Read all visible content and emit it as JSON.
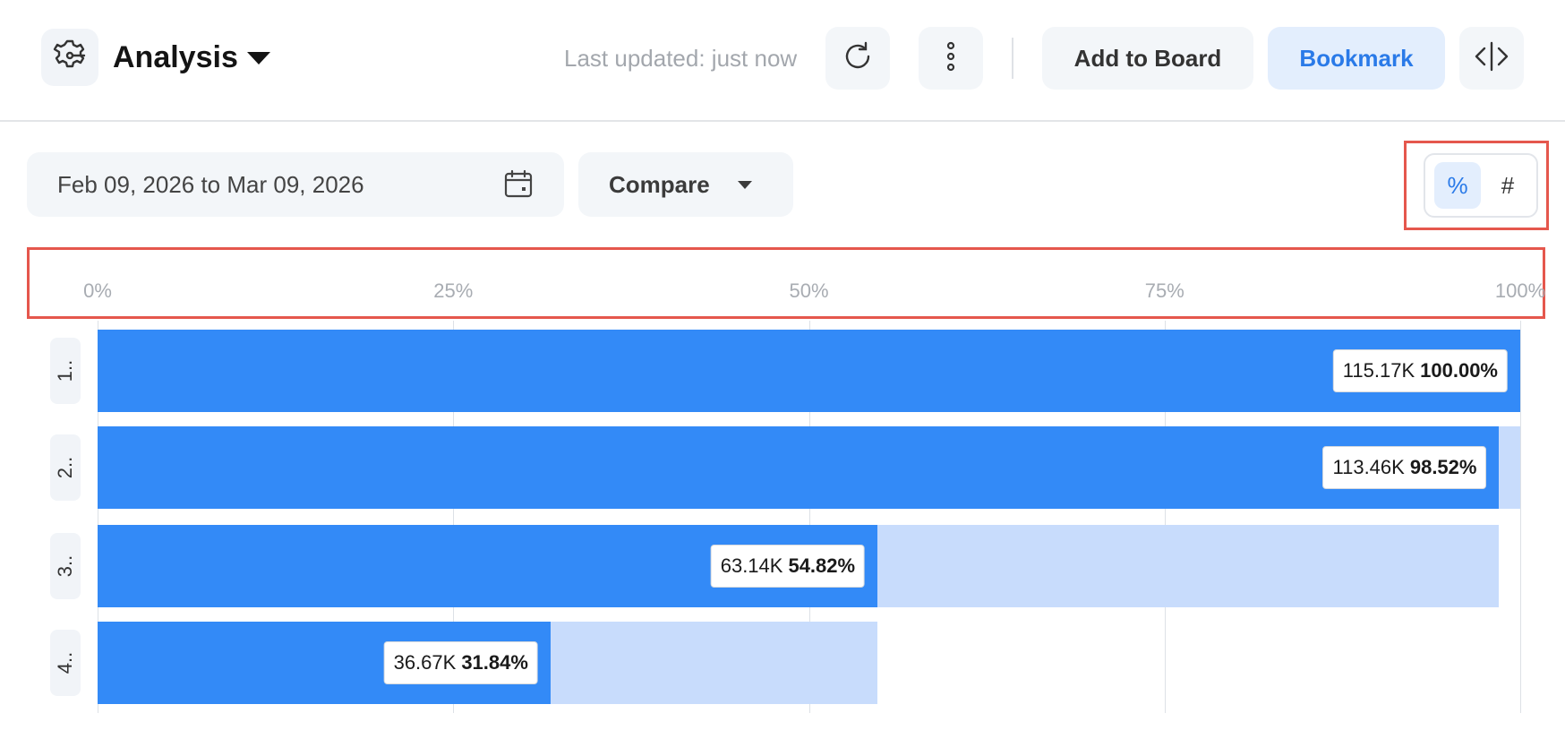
{
  "header": {
    "title": "Analysis",
    "last_updated": "Last updated: just now",
    "add_to_board_label": "Add to Board",
    "bookmark_label": "Bookmark"
  },
  "toolbar": {
    "date_range": "Feb 09, 2026 to Mar 09, 2026",
    "compare_label": "Compare",
    "toggle": {
      "percent_label": "%",
      "count_label": "#",
      "selected": "percent"
    }
  },
  "icons": {
    "app": "gear-flow-icon",
    "refresh": "refresh-icon",
    "more": "kebab-icon",
    "code": "code-icon",
    "calendar": "calendar-icon"
  },
  "colors": {
    "accent": "#2a7ae8",
    "bar": "#338af7",
    "bar_ghost": "#c8dcfc",
    "highlight": "#e5574d"
  },
  "chart_data": {
    "type": "bar",
    "orientation": "horizontal",
    "xlim": [
      0,
      100
    ],
    "ticks": [
      "0%",
      "25%",
      "50%",
      "75%",
      "100%"
    ],
    "grid": true,
    "categories": [
      "1..",
      "2..",
      "3..",
      "4.."
    ],
    "counts": [
      "115.17K",
      "113.46K",
      "63.14K",
      "36.67K"
    ],
    "percents": [
      "100.00%",
      "98.52%",
      "54.82%",
      "31.84%"
    ],
    "values": [
      100.0,
      98.52,
      54.82,
      31.84
    ]
  }
}
